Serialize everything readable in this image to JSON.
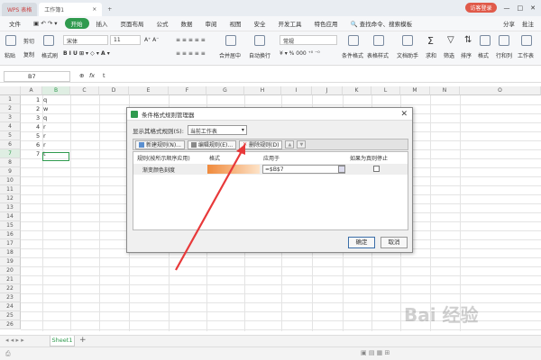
{
  "titlebar": {
    "app_tab": "WPS 表格",
    "doc_tab": "工作簿1",
    "login": "访客登录"
  },
  "menubar": {
    "file": "文件",
    "items": [
      "开始",
      "插入",
      "页面布局",
      "公式",
      "数据",
      "审阅",
      "视图",
      "安全",
      "开发工具",
      "特色应用"
    ],
    "active": "开始",
    "search": "查找命令、搜索模板",
    "share": "分享",
    "batch": "批注"
  },
  "ribbon": {
    "paste": "粘贴",
    "cut": "剪切",
    "copy": "复制",
    "format_painter": "格式刷",
    "font": "宋体",
    "size": "11",
    "merge": "合并居中",
    "wrap": "自动换行",
    "number_format": "常规",
    "cond_format": "条件格式",
    "table_style": "表格样式",
    "doc_assistant": "文档助手",
    "sum": "求和",
    "filter": "筛选",
    "sort": "排序",
    "format": "格式",
    "rowcol": "行和列",
    "sheet": "工作表"
  },
  "formulabar": {
    "cell_ref": "B7",
    "fx": "fx",
    "value": "t"
  },
  "grid": {
    "columns": [
      "A",
      "B",
      "C",
      "D",
      "E",
      "F",
      "G",
      "H",
      "I",
      "J",
      "K",
      "L",
      "M",
      "N",
      "O"
    ],
    "rows": [
      "1",
      "2",
      "3",
      "4",
      "5",
      "6",
      "7",
      "8",
      "9",
      "10",
      "11",
      "12",
      "13",
      "14",
      "15",
      "16",
      "17",
      "18",
      "19",
      "20",
      "21",
      "22",
      "23",
      "24",
      "25",
      "26"
    ],
    "cells": [
      {
        "a": "1",
        "b": "q"
      },
      {
        "a": "2",
        "b": "w"
      },
      {
        "a": "3",
        "b": "q"
      },
      {
        "a": "4",
        "b": "r"
      },
      {
        "a": "5",
        "b": "r"
      },
      {
        "a": "6",
        "b": "r"
      },
      {
        "a": "7",
        "b": "t"
      }
    ]
  },
  "dialog": {
    "title": "条件格式规则管理器",
    "show_label": "显示其格式规则(S):",
    "scope": "当前工作表",
    "new_rule": "新建规则(N)...",
    "edit_rule": "编辑规则(E)...",
    "delete_rule": "删除规则(D)",
    "col_rule": "规则(按所示顺序应用)",
    "col_format": "格式",
    "col_applies": "应用于",
    "col_stop": "如果为真则停止",
    "rule_name": "渐变颜色刻度",
    "applies_to": "=$B$7",
    "ok": "确定",
    "cancel": "取消"
  },
  "sheetbar": {
    "sheet": "Sheet1",
    "add": "+"
  },
  "watermark": "Bai 经验"
}
